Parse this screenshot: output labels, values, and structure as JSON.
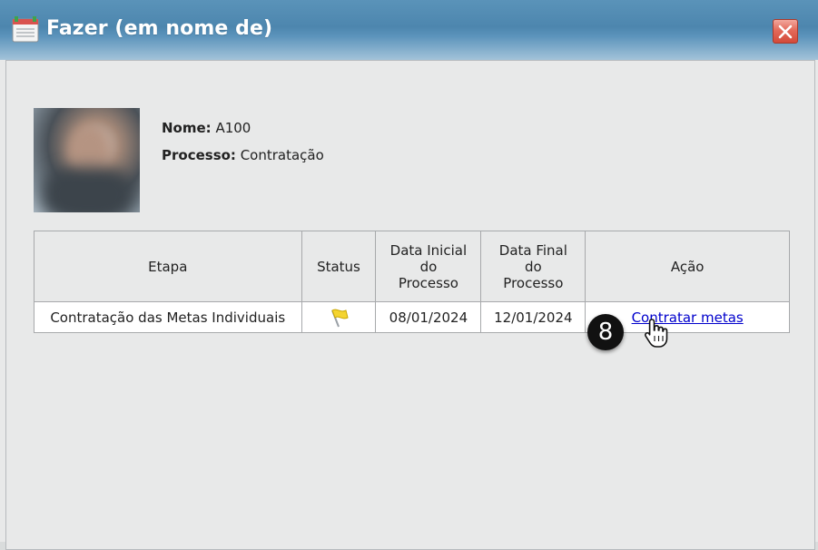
{
  "window": {
    "title": "Fazer (em nome de)",
    "close_icon": "close-icon"
  },
  "profile": {
    "nome_label": "Nome:",
    "nome_value": "A100",
    "processo_label": "Processo:",
    "processo_value": "Contratação"
  },
  "table": {
    "headers": {
      "etapa": "Etapa",
      "status": "Status",
      "data_inicial": [
        "Data Inicial",
        "do",
        "Processo"
      ],
      "data_final": [
        "Data Final",
        "do",
        "Processo"
      ],
      "acao": "Ação"
    },
    "rows": [
      {
        "etapa": "Contratação das Metas Individuais",
        "status_icon": "yellow-flag-icon",
        "data_inicial": "08/01/2024",
        "data_final": "12/01/2024",
        "acao": "Contratar metas"
      }
    ]
  },
  "annotation": {
    "step_number": "8"
  },
  "colors": {
    "titlebar": "#5a93b9",
    "link": "#0000cc",
    "flag": "#f4d430",
    "close_button": "#d34a3a"
  }
}
